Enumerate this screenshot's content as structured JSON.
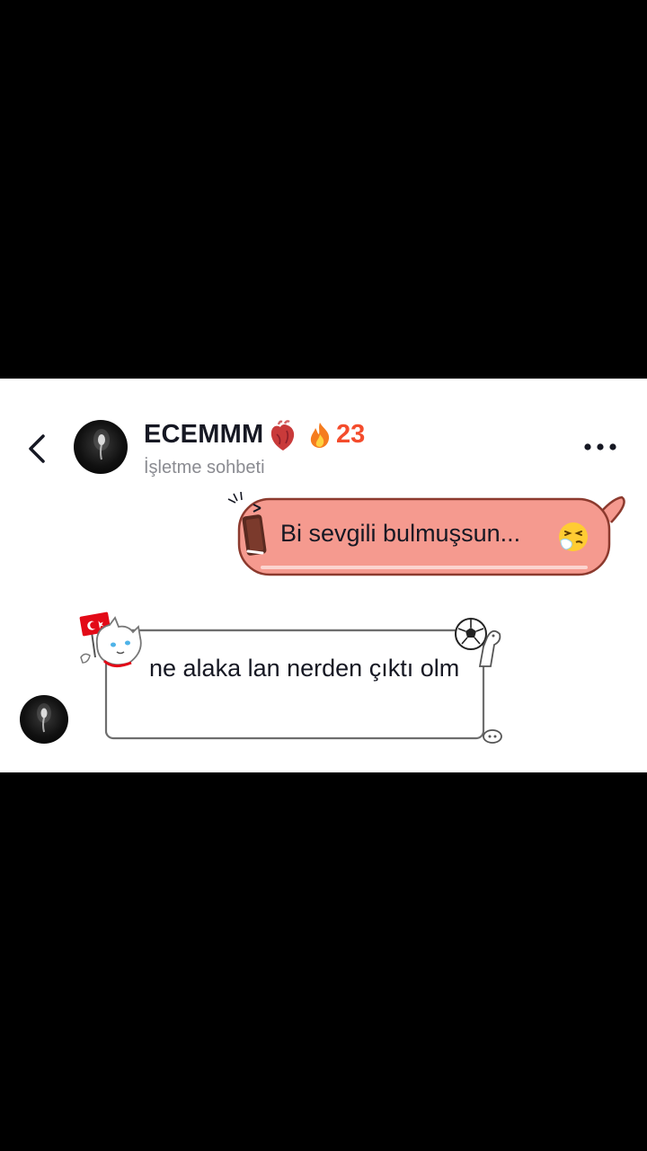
{
  "header": {
    "contact_name": "ECEMMM",
    "streak_count": "23",
    "subtitle": "İşletme sohbeti"
  },
  "icons": {
    "back": "chevron-left-icon",
    "more": "more-dots-icon",
    "heart": "anatomical-heart-icon",
    "fire": "fire-icon",
    "sneeze": "sneezing-face-icon"
  },
  "messages": [
    {
      "direction": "sent",
      "text": "Bi sevgili bulmuşsun... "
    },
    {
      "direction": "received",
      "text": "ne alaka lan nerden çıktı olm"
    }
  ],
  "colors": {
    "sent_bubble": "#f59a8f",
    "sent_bubble_border": "#8c3a2e",
    "streak": "#f44c2c",
    "name": "#161823",
    "subtitle": "#8a8b91"
  }
}
